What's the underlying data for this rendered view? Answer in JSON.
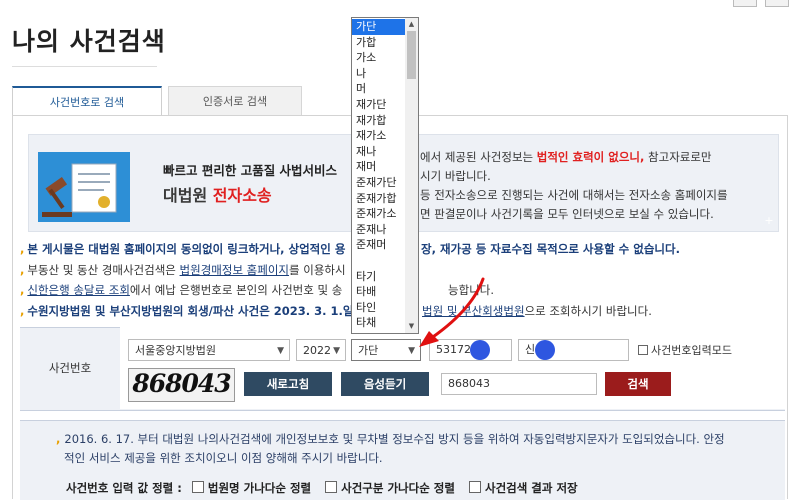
{
  "page": {
    "title": "나의 사건검색"
  },
  "tabs": [
    {
      "label": "사건번호로 검색",
      "active": true
    },
    {
      "label": "인증서로 검색",
      "active": false
    }
  ],
  "banner": {
    "line1": "빠르고 편리한 고품질 사법서비스",
    "brand_a": "대법원",
    "brand_b": "전자소송",
    "right_l1_a": "에서 제공된 사건정보는 ",
    "right_l1_red": "법적인 효력이 없으니,",
    "right_l1_b": " 참고자료로만",
    "right_l2": "시기 바랍니다.",
    "right_l3": "등 전자소송으로 진행되는 사건에 대해서는 전자소송 홈페이지를",
    "right_l4": "면 판결문이나 사건기록을 모두 인터넷으로 보실 수 있습니다.",
    "plus": "+"
  },
  "notices": [
    {
      "text": "본 게시물은 대법원 홈페이지의 동의없이 링크하거나, 상업적인 용",
      "text_b": "장, 재가공 등 자료수집 목적으로 사용할 수 없습니다."
    },
    {
      "pre": "부동산 및 동산 경매사건검색은 ",
      "link": "법원경매정보 홈페이지",
      "post": "를 이용하시"
    },
    {
      "link": "신한은행 송달료 조회",
      "post": "에서 예납 은행번호로 본인의 사건번호 및 송",
      "post_b": "능합니다."
    },
    {
      "text": "수원지방법원 및 부산지방법원의 회생/파산 사건은 2023. 3. 1.일",
      "link_b": "법원 및 부산회생법원",
      "post_b": "으로 조회하시기 바랍니다."
    }
  ],
  "search": {
    "label": "사건번호",
    "court": "서울중앙지방법원",
    "year": "2022",
    "case_type": "가단",
    "case_number": "53172",
    "party_name": "신",
    "input_mode_label": "사건번호입력모드",
    "captcha_text": "868043",
    "captcha_input": "868043",
    "refresh_label": "새로고침",
    "audio_label": "음성듣기",
    "search_label": "검색"
  },
  "bottom": {
    "line1": "2016. 6. 17. 부터 대법원 나의사건검색에 개인정보보호 및 무차별 정보수집 방지 등을 위하여 자동입력방지문자가 도입되었습니다. 안정",
    "line2": "적인 서비스 제공을 위한 조치이오니 이점 양해해 주시기 바랍니다.",
    "sort_label": "사건번호 입력 값 정렬 :",
    "opt1": "법원명 가나다순 정렬",
    "opt2": "사건구분 가나다순 정렬",
    "opt3": "사건검색 결과 저장"
  },
  "case_type_options": [
    "가단",
    "가합",
    "가소",
    "나",
    "머",
    "재가단",
    "재가합",
    "재가소",
    "재나",
    "재머",
    "준재가단",
    "준재가합",
    "준재가소",
    "준재나",
    "준재머",
    "",
    "타기",
    "타배",
    "타인",
    "타채"
  ],
  "colors": {
    "accent": "#1e73e8",
    "navy": "#2f4a62",
    "red": "#9b1c1c",
    "annotation": "#e01010"
  }
}
